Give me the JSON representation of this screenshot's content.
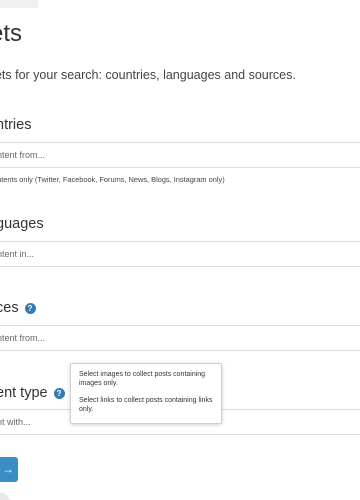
{
  "page": {
    "title": "ets",
    "subtitle": "gets for your search: countries, languages and sources."
  },
  "countries": {
    "title": "ntries",
    "placeholder": "ontent from...",
    "hint": "ontents only (Twitter, Facebook, Forums, News, Blogs, Instagram only)"
  },
  "languages": {
    "title": "guages",
    "placeholder": "ontent in..."
  },
  "sources": {
    "title": "ces",
    "help_icon": "?",
    "placeholder": "ontent from..."
  },
  "content_type": {
    "title": "ent type",
    "help_icon": "?",
    "placeholder": "ent with...",
    "tooltip": {
      "line1": "Select images to collect posts containing images only.",
      "line2": "Select links to collect posts containing links only."
    }
  },
  "next_button": {
    "label": "→"
  },
  "colors": {
    "accent": "#3c8dc6",
    "border": "#dddddd",
    "help_icon": "#337ab7"
  }
}
